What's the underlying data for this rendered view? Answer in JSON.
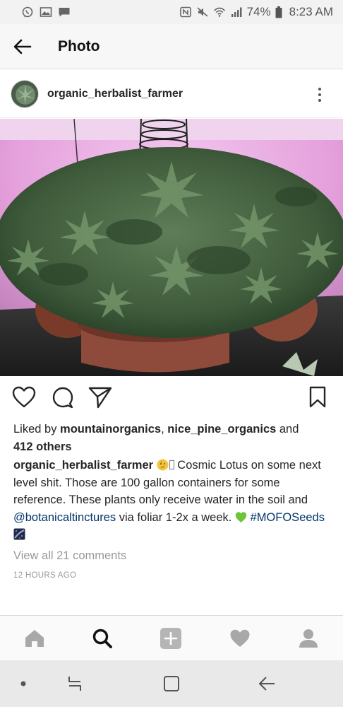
{
  "status_bar": {
    "battery": "74%",
    "time": "8:23 AM",
    "left_icons": [
      "whatsapp-icon",
      "image-icon",
      "message-icon"
    ],
    "right_icons": [
      "nfc-icon",
      "mute-icon",
      "wifi-icon",
      "signal-icon",
      "battery-icon"
    ]
  },
  "app_bar": {
    "title": "Photo",
    "back_icon": "arrow-left-icon"
  },
  "post": {
    "username": "organic_herbalist_farmer",
    "likes": {
      "prefix": "Liked by ",
      "user1": "mountainorganics",
      "separator": ", ",
      "user2": "nice_pine_organics",
      "and": " and",
      "others": "412 others"
    },
    "caption": {
      "username": "organic_herbalist_farmer",
      "part1": " Cosmic Lotus on some next level shit. Those are 100 gallon containers for some reference. These plants only receive water in the soil and ",
      "mention": "@botanicaltinctures",
      "part2": " via foliar 1-2x a week. ",
      "hashtag": "#MOFOSeeds"
    },
    "view_comments": "View all 21 comments",
    "timestamp": "12 HOURS AGO"
  },
  "actions": [
    "heart-icon",
    "comment-icon",
    "share-icon",
    "bookmark-icon"
  ],
  "tabs": [
    "home-icon",
    "search-icon",
    "add-icon",
    "activity-icon",
    "profile-icon"
  ],
  "colors": {
    "link": "#003569",
    "text": "#262626",
    "muted": "#999999",
    "grow_tent": "#e8a6e0"
  }
}
